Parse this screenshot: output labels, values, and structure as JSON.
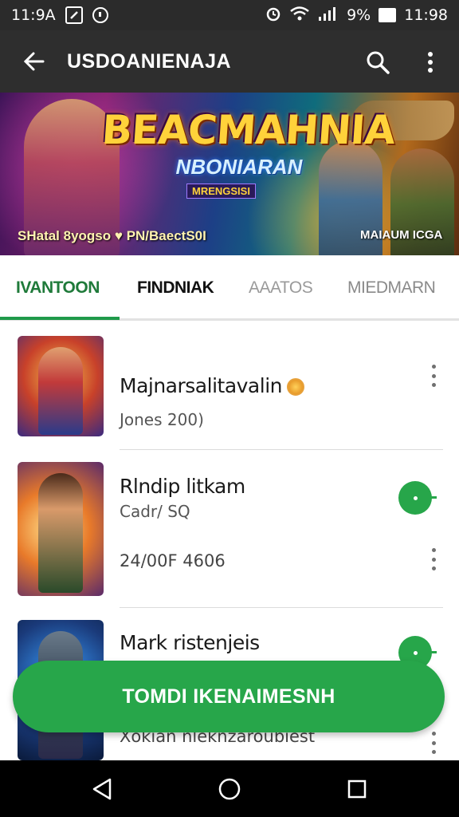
{
  "status_bar": {
    "time_left": "11:9A",
    "icons_left": [
      "gallery-icon",
      "sync-icon"
    ],
    "signal_text": "9%",
    "time_right": "11:98",
    "icons_right": [
      "alarm-icon",
      "wifi-icon",
      "signal-icon",
      "battery-icon"
    ]
  },
  "app_bar": {
    "title": "USDOANIENAJA",
    "icons": [
      "back-arrow-icon",
      "search-icon",
      "more-vert-icon"
    ]
  },
  "banner": {
    "title": "BEACMAHNIA",
    "subtitle": "NBONIARAN",
    "tag": "MRENGSISI",
    "left_caption": "SHatal 8yogso ♥ PN/BaectS0I",
    "right_caption": "MAIAUM ICGA"
  },
  "tabs": [
    {
      "label": "IVANTOON",
      "active": true
    },
    {
      "label": "FINDNIAK",
      "active": false
    },
    {
      "label": "AAATOS",
      "active": false
    },
    {
      "label": "MIEDMARN",
      "active": false
    }
  ],
  "list": [
    {
      "title": "Majnarsalitavalin",
      "subtitle": "Jones 200)",
      "meta": "",
      "has_coin": true
    },
    {
      "title": "Rlndip litkam",
      "subtitle": "Cadr/ SQ",
      "meta": "24/00F 4606",
      "has_coin": false
    },
    {
      "title": "Mark ristenjeis",
      "subtitle": "",
      "meta": "Xokian nleknzaroubiest",
      "has_coin": false
    }
  ],
  "cta": {
    "label": "TOMDI IKENAIMESNH"
  },
  "nav_bar": {
    "icons": [
      "back-triangle-icon",
      "home-circle-icon",
      "recents-square-icon"
    ]
  },
  "colors": {
    "accent_green": "#27a64a",
    "tab_active": "#1f7a3a",
    "app_bar": "#2e2e2e",
    "status_bar": "#2b2b2b"
  }
}
